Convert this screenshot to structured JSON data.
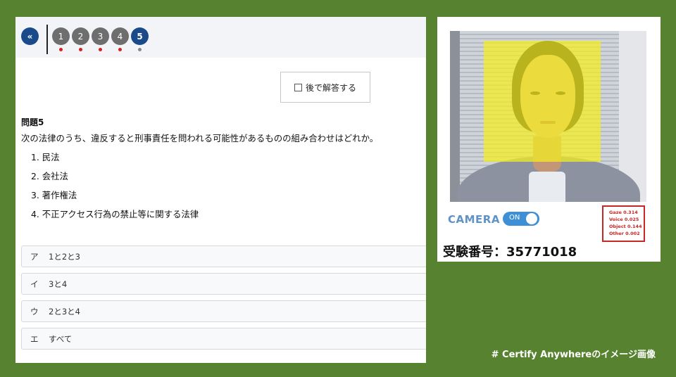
{
  "nav": {
    "back_label": "«",
    "questions": [
      {
        "label": "1",
        "current": false
      },
      {
        "label": "2",
        "current": false
      },
      {
        "label": "3",
        "current": false
      },
      {
        "label": "4",
        "current": false
      },
      {
        "label": "5",
        "current": true
      }
    ]
  },
  "later": {
    "label": "後で解答する",
    "checked": false
  },
  "question": {
    "title": "問題5",
    "text": "次の法律のうち、違反すると刑事責任を問われる可能性があるものの組み合わせはどれか。",
    "items": [
      "1. 民法",
      "2. 会社法",
      "3. 著作権法",
      "4. 不正アクセス行為の禁止等に関する法律"
    ]
  },
  "answers": [
    {
      "kana": "ア",
      "text": "1と2と3"
    },
    {
      "kana": "イ",
      "text": "3と4"
    },
    {
      "kana": "ウ",
      "text": "2と3と4"
    },
    {
      "kana": "エ",
      "text": "すべて"
    }
  ],
  "camera": {
    "label": "CAMERA",
    "toggle": "ON",
    "scores": {
      "gaze": "Gaze 0.314",
      "voice": "Voice 0.025",
      "object": "Object 0.144",
      "other": "Other 0.002"
    },
    "exam_number": "受験番号：35771018"
  },
  "caption": "# Certify Anywhereのイメージ画像",
  "colors": {
    "background": "#57822f",
    "accent": "#1b4a8a",
    "toggle": "#3d8fd6",
    "alert": "#c62828",
    "face_box": "#f5ee1e"
  }
}
